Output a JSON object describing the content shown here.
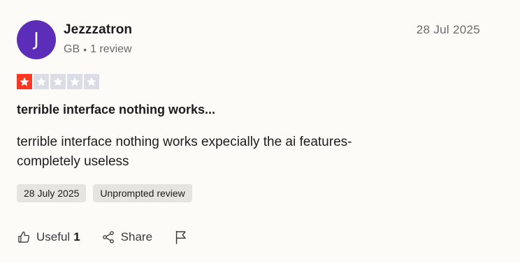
{
  "reviewer": {
    "avatar_initial": "J",
    "avatar_color": "#5b2db8",
    "name": "Jezzzatron",
    "country": "GB",
    "separator": "•",
    "review_count": "1 review"
  },
  "review": {
    "date": "28 Jul 2025",
    "rating": 1,
    "rating_max": 5,
    "star_filled_color": "#ff3722",
    "star_empty_color": "#dcdce6",
    "title": "terrible interface nothing works...",
    "body": "terrible interface nothing works expecially the ai features- completely useless",
    "tags": [
      {
        "label": "28 July 2025"
      },
      {
        "label": "Unprompted review"
      }
    ]
  },
  "actions": {
    "useful_label": "Useful",
    "useful_count": "1",
    "useful_icon": "thumbs-up-icon",
    "share_label": "Share",
    "share_icon": "share-icon",
    "flag_icon": "flag-icon"
  }
}
